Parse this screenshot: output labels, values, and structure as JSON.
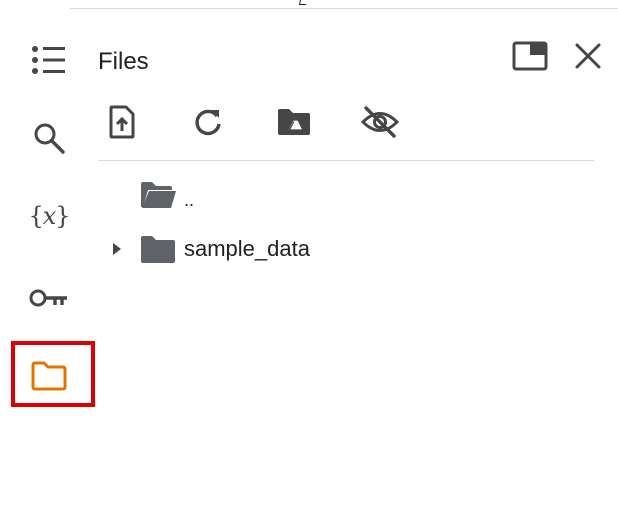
{
  "panel": {
    "title": "Files"
  },
  "rail": {
    "items": [
      {
        "name": "table-of-contents",
        "icon": "list-icon"
      },
      {
        "name": "search",
        "icon": "search-icon"
      },
      {
        "name": "variables",
        "icon": "variables-icon",
        "glyph_open": "{",
        "glyph_x": "x",
        "glyph_close": "}"
      },
      {
        "name": "secrets",
        "icon": "key-icon"
      },
      {
        "name": "files",
        "icon": "folder-icon",
        "active": true,
        "accent": "#e37400"
      }
    ],
    "highlight_color": "#e00000"
  },
  "toolbar": {
    "items": [
      {
        "name": "upload",
        "icon": "upload-file-icon"
      },
      {
        "name": "refresh",
        "icon": "refresh-icon"
      },
      {
        "name": "mount-drive",
        "icon": "google-drive-folder-icon"
      },
      {
        "name": "toggle-hidden",
        "icon": "eye-off-icon"
      }
    ]
  },
  "header_actions": [
    {
      "name": "open-in-window",
      "icon": "window-icon"
    },
    {
      "name": "close",
      "icon": "close-icon"
    }
  ],
  "tree": {
    "items": [
      {
        "label": "..",
        "icon": "open-folder-icon",
        "expandable": false
      },
      {
        "label": "sample_data",
        "icon": "folder-icon",
        "expandable": true
      }
    ]
  },
  "colors": {
    "icon": "#444746",
    "folder_fill": "#5f6368",
    "divider": "#dadce0"
  }
}
